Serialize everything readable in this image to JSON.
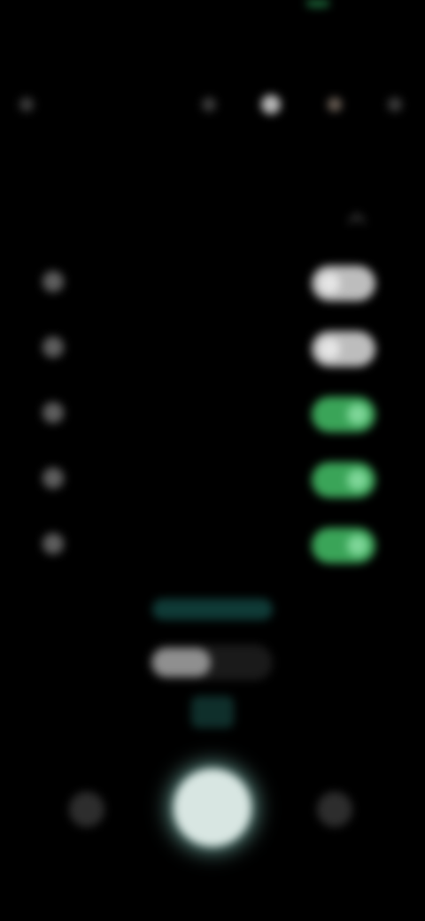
{
  "status_bar": {
    "time": "",
    "indicator_color": "#1d6b3b"
  },
  "top_toolbar": {
    "icons": [
      "back-icon",
      "flash-icon",
      "settings-icon",
      "timer-icon",
      "more-icon"
    ]
  },
  "settings_panel": {
    "title": "",
    "rows": [
      {
        "icon": "grid-icon",
        "label": "",
        "enabled": false
      },
      {
        "icon": "level-icon",
        "label": "",
        "enabled": false
      },
      {
        "icon": "location-icon",
        "label": "",
        "enabled": true
      },
      {
        "icon": "sound-icon",
        "label": "",
        "enabled": true
      },
      {
        "icon": "mirror-icon",
        "label": "",
        "enabled": true
      }
    ]
  },
  "zoom": {
    "options": [
      "",
      ""
    ],
    "selected_index": 0
  },
  "modes": {
    "items": [
      "",
      "",
      "",
      "",
      "",
      ""
    ],
    "active_index": 2
  },
  "colors": {
    "toggle_on": "#3aa458",
    "toggle_off": "#bdbdbd",
    "accent": "#0f3a36",
    "shutter": "#d8e6e2"
  }
}
